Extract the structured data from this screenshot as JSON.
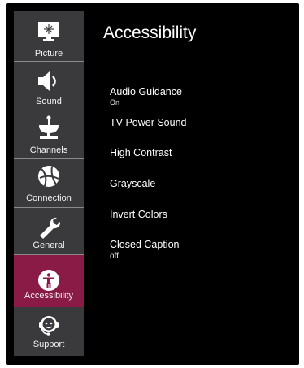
{
  "sidebar": {
    "items": [
      {
        "label": "Picture",
        "icon": "picture-icon"
      },
      {
        "label": "Sound",
        "icon": "speaker-icon"
      },
      {
        "label": "Channels",
        "icon": "satellite-dish-icon"
      },
      {
        "label": "Connection",
        "icon": "globe-icon"
      },
      {
        "label": "General",
        "icon": "wrench-icon"
      },
      {
        "label": "Accessibility",
        "icon": "accessibility-icon",
        "active": true
      },
      {
        "label": "Support",
        "icon": "headset-icon"
      }
    ]
  },
  "main": {
    "title": "Accessibility",
    "options": [
      {
        "name": "Audio Guidance",
        "value": "On"
      },
      {
        "name": "TV Power Sound"
      },
      {
        "name": "High Contrast"
      },
      {
        "name": "Grayscale"
      },
      {
        "name": "Invert Colors"
      },
      {
        "name": "Closed Caption",
        "value": "off"
      }
    ]
  },
  "colors": {
    "sidebar_bg": "#3a3a3c",
    "active_bg": "#8a1b47",
    "screen_bg": "#000000",
    "text": "#ffffff"
  }
}
